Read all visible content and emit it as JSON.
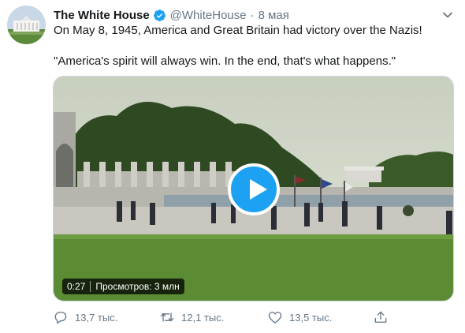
{
  "tweet": {
    "author": {
      "display_name": "The White House",
      "handle": "@WhiteHouse",
      "verified": true,
      "avatar_icon": "white-house-avatar"
    },
    "separator": "·",
    "time": "8 мая",
    "text_line1": "On May 8, 1945, America and Great Britain had victory over the Nazis!",
    "text_line2": "\"America's spirit will always win. In the end, that's what happens.\"",
    "media": {
      "type": "video",
      "duration": "0:27",
      "views": "Просмотров: 3 млн",
      "play_icon": "play-icon"
    },
    "actions": {
      "replies": "13,7 тыс.",
      "retweets": "12,1 тыс.",
      "likes": "13,5 тыс."
    },
    "colors": {
      "accent": "#1da1f2",
      "secondary_text": "#657786",
      "primary_text": "#14171a"
    }
  }
}
